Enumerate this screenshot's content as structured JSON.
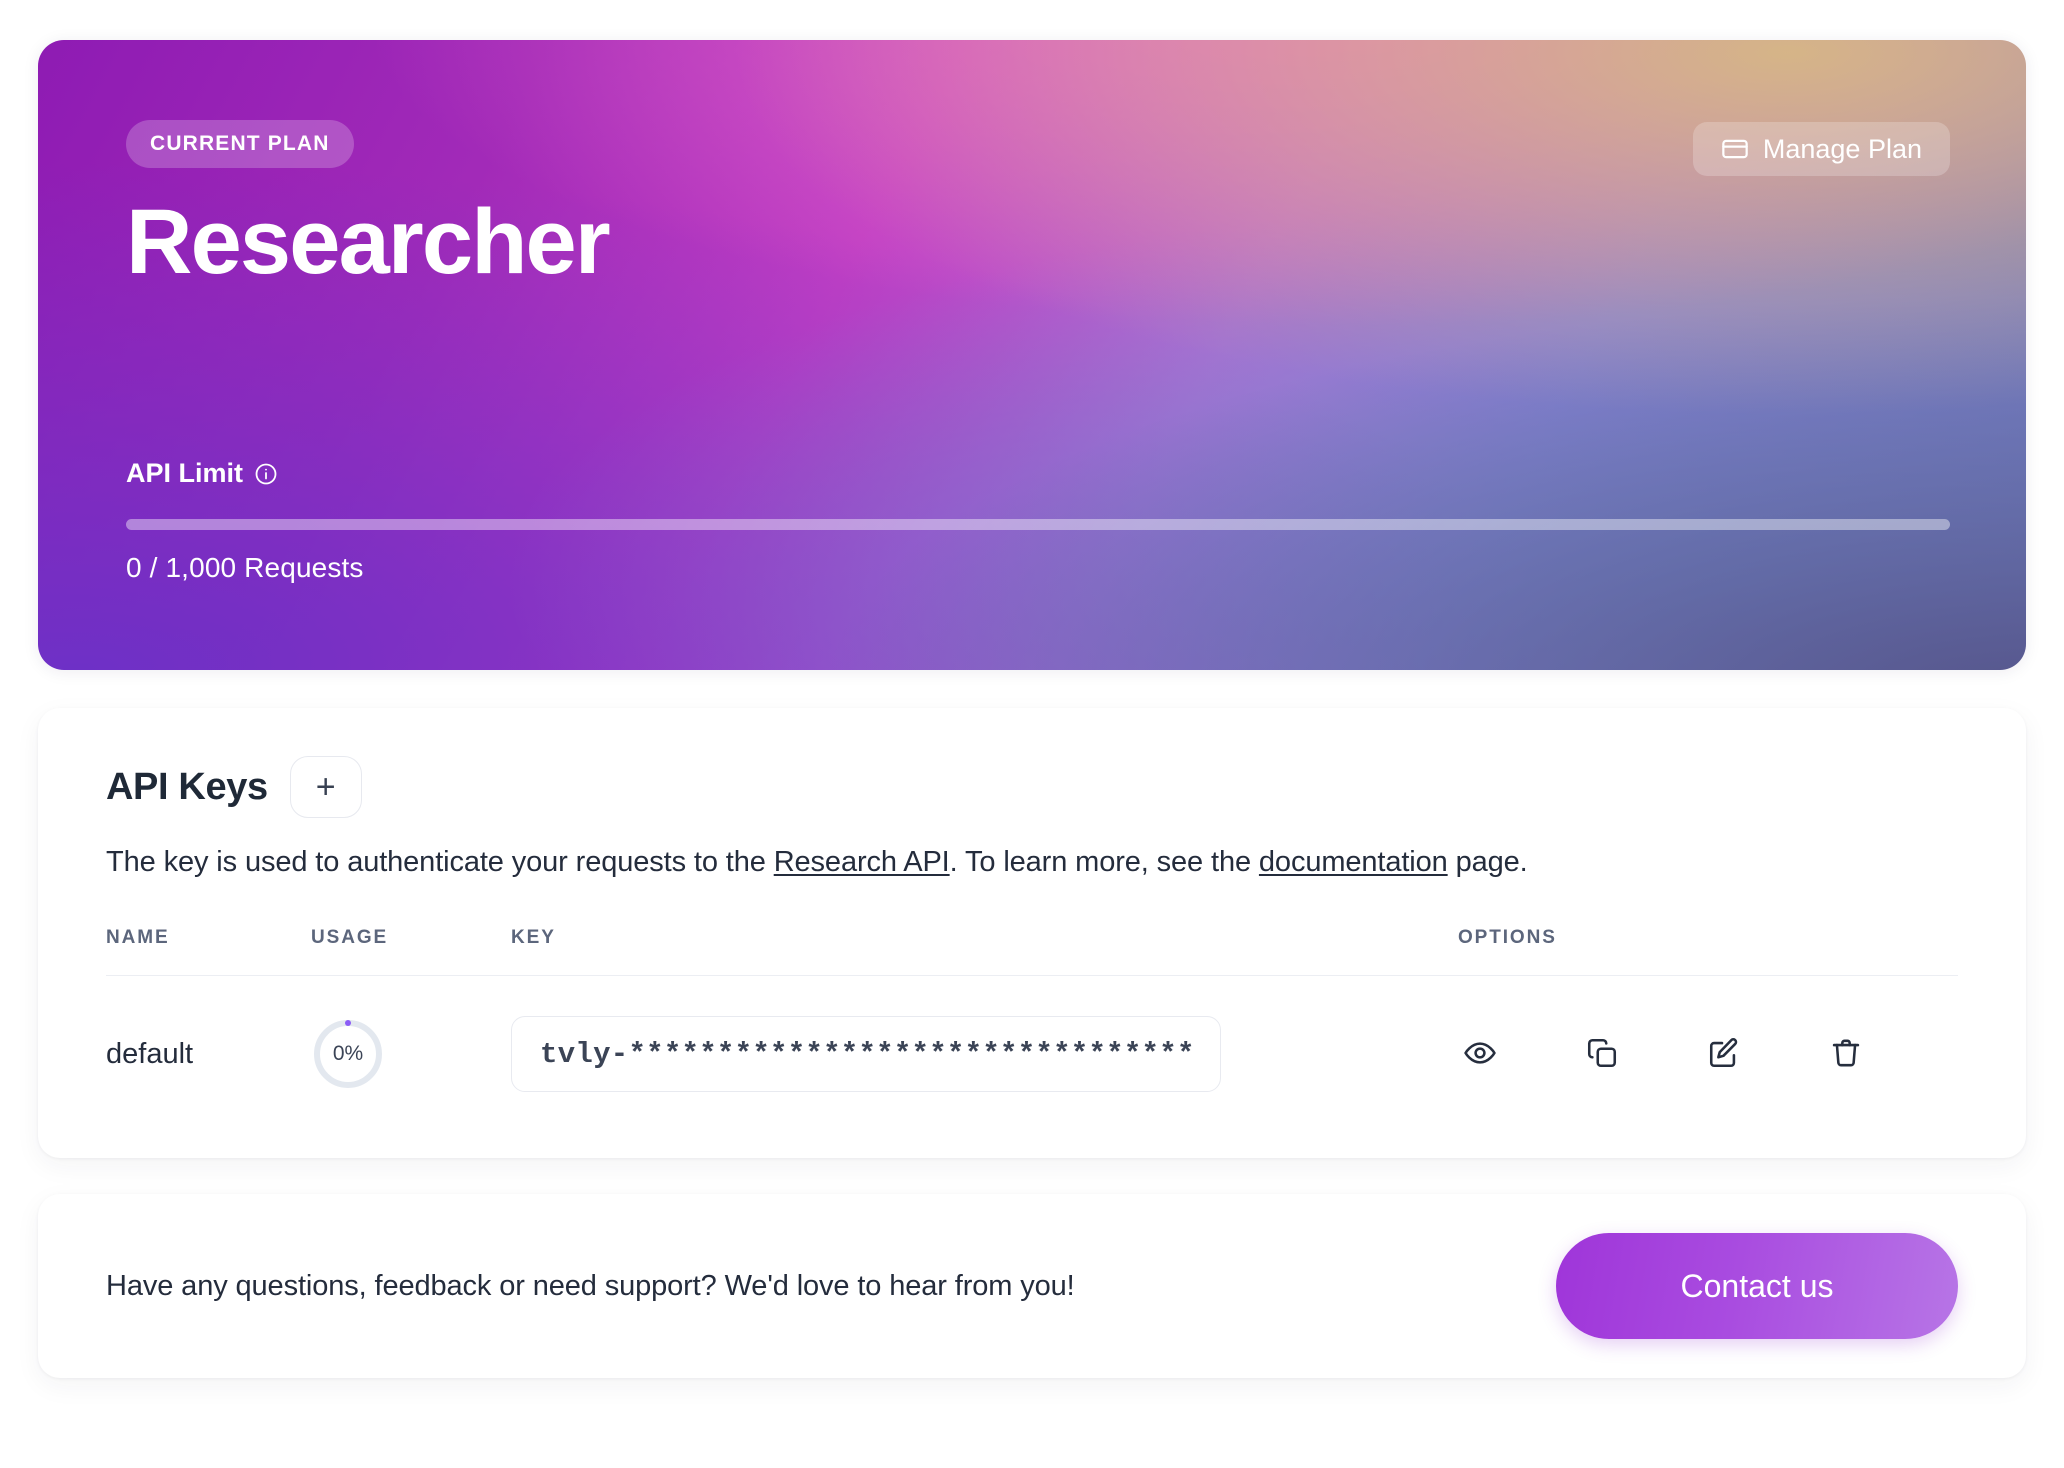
{
  "hero": {
    "badge_label": "CURRENT PLAN",
    "plan_name": "Researcher",
    "manage_plan_label": "Manage Plan",
    "manage_plan_icon": "credit-card-icon",
    "limit_label": "API Limit",
    "limit_info_icon": "info-icon",
    "limit_count_text": "0 / 1,000 Requests",
    "limit_used": 0,
    "limit_total": 1000,
    "limit_percent": 0,
    "gradient": {
      "top_left": "#8E1BB3",
      "top_center": "#E064C8",
      "top_right": "#D6B686",
      "bottom_left": "#6E30C6",
      "bottom_center": "#768ED2",
      "bottom_right": "#56568C"
    }
  },
  "api_keys": {
    "title": "API Keys",
    "add_button_label": "+",
    "description": {
      "part1": "The key is used to authenticate your requests to the ",
      "link1": "Research API",
      "part2": ". To learn more, see the ",
      "link2": "documentation",
      "part3": " page."
    },
    "columns": [
      "NAME",
      "USAGE",
      "KEY",
      "OPTIONS"
    ],
    "rows": [
      {
        "name": "default",
        "usage_percent": "0%",
        "usage_value": 0,
        "key": "tvly-********************************",
        "options": [
          {
            "icon": "eye-icon",
            "label": "Show key"
          },
          {
            "icon": "copy-icon",
            "label": "Copy key"
          },
          {
            "icon": "edit-icon",
            "label": "Edit key"
          },
          {
            "icon": "trash-icon",
            "label": "Delete key"
          }
        ]
      }
    ]
  },
  "support": {
    "message": "Have any questions, feedback or need support? We'd love to hear from you!",
    "contact_label": "Contact us",
    "accent_color": "#A94CE0"
  }
}
